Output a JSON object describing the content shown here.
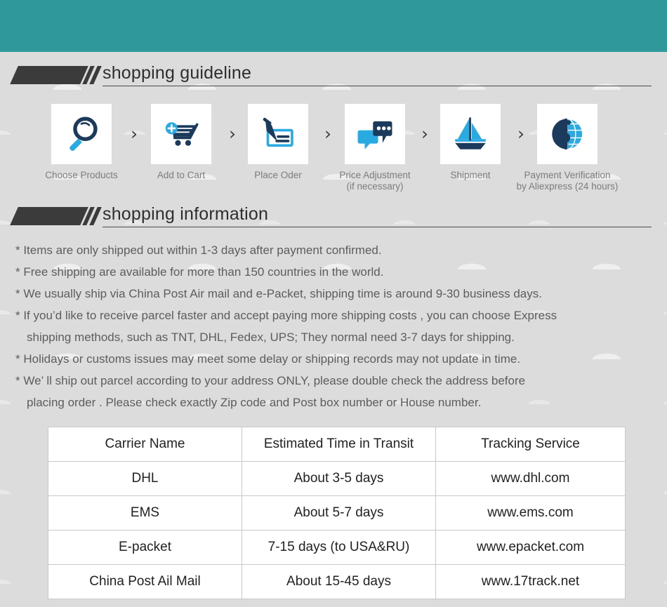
{
  "theme": {
    "banner_color": "#2f989b",
    "page_background": "#dcdcdc",
    "icon_dark": "#1b3a5c",
    "icon_accent": "#29aae1",
    "body_text": "#5d5d5d",
    "heading_text": "#2e2e2e",
    "table_border": "#c9c9c9"
  },
  "sections": {
    "guideline": {
      "title": "shopping guideline"
    },
    "information": {
      "title": "shopping information"
    }
  },
  "steps": [
    {
      "icon": "magnifier-icon",
      "caption": "Choose Products"
    },
    {
      "icon": "add-to-cart-icon",
      "caption": "Add to Cart"
    },
    {
      "icon": "pen-check-icon",
      "caption": "Place Oder"
    },
    {
      "icon": "chat-bubbles-icon",
      "caption_line1": "Price Adjustment",
      "caption_line2": "(if necessary)"
    },
    {
      "icon": "sailboat-icon",
      "caption": "Shipment"
    },
    {
      "icon": "dollar-globe-icon",
      "caption_line1": "Payment Verification",
      "caption_line2": "by  Aliexpress (24 hours)"
    }
  ],
  "step_separator": "›",
  "info_lines": [
    {
      "text": "* Items are only shipped out within 1-3 days after payment confirmed.",
      "continuation": false
    },
    {
      "text": "* Free shipping are available for more than 150 countries in the world.",
      "continuation": false
    },
    {
      "text": "* We usually ship via China Post Air mail and e-Packet, shipping time is around 9-30 business days.",
      "continuation": false
    },
    {
      "text": "* If you’d like to receive parcel faster and accept paying more shipping costs , you can choose Express",
      "continuation": false
    },
    {
      "text": "shipping methods, such as TNT, DHL, Fedex, UPS; They normal need 3-7 days for shipping.",
      "continuation": true
    },
    {
      "text": "* Holidays or customs issues may meet some delay or shipping records may not update in time.",
      "continuation": false
    },
    {
      "text": "* We’ ll ship out parcel according to your address ONLY, please double check the address before",
      "continuation": false
    },
    {
      "text": "placing order . Please check exactly Zip code and Post box number or House number.",
      "continuation": true
    }
  ],
  "carrier_table": {
    "headers": [
      "Carrier Name",
      "Estimated Time in Transit",
      "Tracking Service"
    ],
    "rows": [
      [
        "DHL",
        "About 3-5 days",
        "www.dhl.com"
      ],
      [
        "EMS",
        "About 5-7 days",
        "www.ems.com"
      ],
      [
        "E-packet",
        "7-15 days (to USA&RU)",
        "www.epacket.com"
      ],
      [
        "China Post Ail Mail",
        "About 15-45 days",
        "www.17track.net"
      ]
    ]
  }
}
